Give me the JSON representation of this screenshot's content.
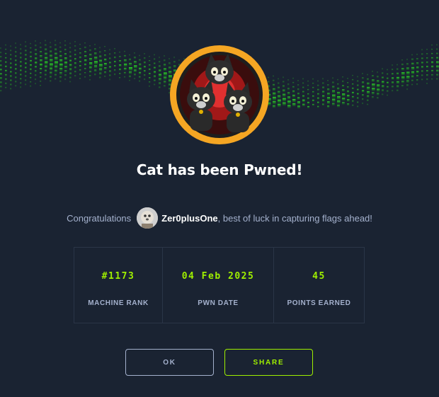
{
  "colors": {
    "background": "#1a2332",
    "accent": "#9fef00",
    "text_muted": "#a4b1cd",
    "badge_ring": "#f5a623"
  },
  "banner": {
    "icon": "matrix-wave-banner"
  },
  "machine": {
    "badge_icon": "three-black-cats-badge"
  },
  "title": "Cat has been Pwned!",
  "congrats": {
    "prefix": "Congratulations",
    "avatar_icon": "user-avatar",
    "username": "Zer0plusOne",
    "suffix": ", best of luck in capturing flags ahead!"
  },
  "stats": [
    {
      "value": "#1173",
      "label": "MACHINE RANK"
    },
    {
      "value": "04 Feb 2025",
      "label": "PWN DATE"
    },
    {
      "value": "45",
      "label": "POINTS EARNED"
    }
  ],
  "buttons": {
    "ok": "OK",
    "share": "SHARE"
  }
}
